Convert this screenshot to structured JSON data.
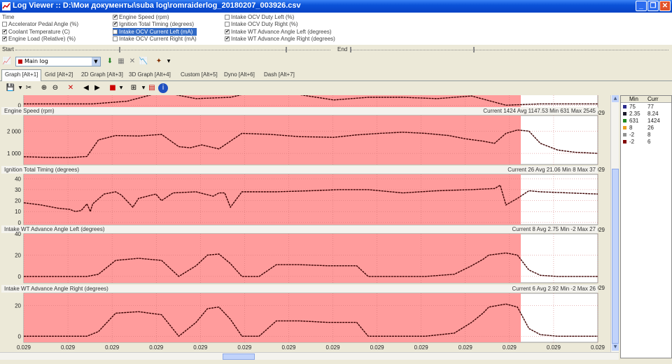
{
  "window": {
    "title": "Log Viewer :: D:\\Мои документы\\suba log\\romraiderlog_20180207_003926.csv"
  },
  "params": {
    "col1": [
      {
        "label": "Time",
        "checked": null
      },
      {
        "label": "Accelerator Pedal Angle (%)",
        "checked": false
      },
      {
        "label": "Coolant Temperature (C)",
        "checked": true
      },
      {
        "label": "Engine Load (Relative) (%)",
        "checked": true
      }
    ],
    "col2": [
      {
        "label": "Engine Speed (rpm)",
        "checked": true
      },
      {
        "label": "Ignition Total Timing (degrees)",
        "checked": true
      },
      {
        "label": "Intake OCV Current Left (mA)",
        "checked": false,
        "selected": true
      },
      {
        "label": "Intake OCV Current Right (mA)",
        "checked": false
      }
    ],
    "col3": [
      {
        "label": "Intake OCV Duty Left (%)",
        "checked": false
      },
      {
        "label": "Intake OCV Duty Right (%)",
        "checked": false
      },
      {
        "label": "Intake WT Advance Angle Left (degrees)",
        "checked": true
      },
      {
        "label": "Intake WT Advance Angle Right (degrees)",
        "checked": true
      }
    ]
  },
  "range": {
    "start_label": "Start",
    "end_label": "End"
  },
  "toolbar": {
    "log_select": "Main log"
  },
  "tabs": [
    "Graph [Alt+1]",
    "Grid [Alt+2]",
    "2D Graph [Alt+3]",
    "3D Graph [Alt+4]",
    "Custom [Alt+5]",
    "Dyno [Alt+6]",
    "Dash [Alt+7]"
  ],
  "side_table": {
    "headers": [
      "Min",
      "Curr"
    ],
    "rows": [
      {
        "color": "#2a2a8c",
        "min": "75",
        "cur": "77"
      },
      {
        "color": "#1a1a2a",
        "min": "2.35",
        "cur": "8.24"
      },
      {
        "color": "#208a20",
        "min": "631",
        "cur": "1424"
      },
      {
        "color": "#e8a020",
        "min": "8",
        "cur": "26"
      },
      {
        "color": "#909090",
        "min": "-2",
        "cur": "8"
      },
      {
        "color": "#800000",
        "min": "-2",
        "cur": "6"
      }
    ]
  },
  "colors": {
    "highlight": "#ff9c9c",
    "trace": "#3a0000",
    "plot_bg": "#ffffff"
  },
  "chart_data": [
    {
      "type": "line",
      "title": "",
      "info": "",
      "yticks": [
        "0"
      ],
      "ylim": [
        -2,
        14
      ],
      "x": [
        0,
        6,
        12,
        18,
        24,
        30,
        36,
        42,
        48,
        54,
        60,
        66,
        72,
        78,
        84,
        90,
        100
      ],
      "values": [
        1,
        1,
        1,
        3,
        10,
        5,
        6,
        12,
        8,
        4,
        6,
        6,
        5,
        7,
        0,
        1,
        1
      ]
    },
    {
      "type": "line",
      "title": "Engine Speed (rpm)",
      "info": "Current 1424 Avg 1147.53 Min 631 Max 2545",
      "yticks": [
        "2 000",
        "1 000"
      ],
      "ylim": [
        500,
        2700
      ],
      "x": [
        0,
        4,
        8,
        11,
        13,
        16,
        20,
        24,
        27,
        29,
        31,
        34,
        38,
        43,
        48,
        54,
        58,
        62,
        66,
        70,
        74,
        77,
        80,
        82,
        84,
        86,
        88,
        90,
        93,
        96,
        100
      ],
      "values": [
        850,
        820,
        810,
        860,
        1600,
        1800,
        1780,
        1850,
        1300,
        1250,
        1380,
        1200,
        1900,
        1850,
        1750,
        1720,
        1830,
        1900,
        1950,
        1900,
        1800,
        1650,
        1550,
        1450,
        1900,
        2050,
        2000,
        1450,
        1150,
        1050,
        1000
      ]
    },
    {
      "type": "line",
      "title": "Ignition Total Timing (degrees)",
      "info": "Current 26 Avg 21.06 Min 8 Max 37",
      "yticks": [
        "40",
        "30",
        "20",
        "10",
        "0"
      ],
      "ylim": [
        -2,
        44
      ],
      "x": [
        0,
        3,
        6,
        8,
        9,
        10,
        11,
        11.6,
        12,
        14,
        16,
        17,
        19,
        20,
        23,
        24,
        26,
        30,
        33,
        34,
        35,
        36,
        38,
        44,
        50,
        55,
        60,
        66,
        72,
        78,
        82,
        83,
        84,
        86,
        88,
        90,
        100
      ],
      "values": [
        18,
        16,
        13,
        12,
        10,
        11,
        17,
        10,
        17,
        26,
        28,
        25,
        14,
        22,
        26,
        20,
        27,
        28,
        24,
        27,
        27,
        14,
        28,
        28,
        29,
        30,
        30,
        27,
        29,
        30,
        31,
        34,
        16,
        22,
        29,
        28,
        26
      ]
    },
    {
      "type": "line",
      "title": "Intake WT Advance Angle Left (degrees)",
      "info": "Current 8 Avg 2.75 Min -2 Max 27",
      "yticks": [
        "40",
        "20",
        "0"
      ],
      "ylim": [
        -6,
        40
      ],
      "x": [
        0,
        6,
        11,
        13,
        16,
        20,
        24,
        27,
        30,
        32,
        34,
        36,
        38,
        41,
        44,
        48,
        53,
        58,
        60,
        62,
        64,
        70,
        75,
        78,
        80,
        81,
        84,
        86,
        88,
        90,
        93,
        96,
        100
      ],
      "values": [
        0,
        0,
        0,
        2,
        15,
        17,
        15,
        0,
        10,
        20,
        21,
        12,
        0,
        0,
        11,
        11,
        10,
        10,
        0,
        0,
        0,
        0,
        2,
        10,
        16,
        20,
        22,
        20,
        6,
        1,
        0,
        0,
        0
      ]
    },
    {
      "type": "line",
      "title": "Intake WT Advance Angle Right (degrees)",
      "info": "Current 6 Avg 2.92 Min -2 Max 26",
      "yticks": [
        "20",
        "0"
      ],
      "ylim": [
        -4,
        28
      ],
      "x": [
        0,
        6,
        11,
        13,
        16,
        20,
        24,
        27,
        30,
        32,
        34,
        36,
        38,
        41,
        44,
        48,
        53,
        58,
        60,
        62,
        64,
        70,
        75,
        78,
        80,
        81,
        84,
        86,
        88,
        90,
        93,
        96,
        100
      ],
      "values": [
        0,
        0,
        0,
        3,
        15,
        16,
        14,
        0,
        9,
        18,
        19,
        11,
        0,
        0,
        10,
        10,
        9,
        9,
        0,
        0,
        0,
        0,
        2,
        9,
        15,
        19,
        21,
        19,
        5,
        1,
        0,
        0,
        0
      ]
    }
  ]
}
